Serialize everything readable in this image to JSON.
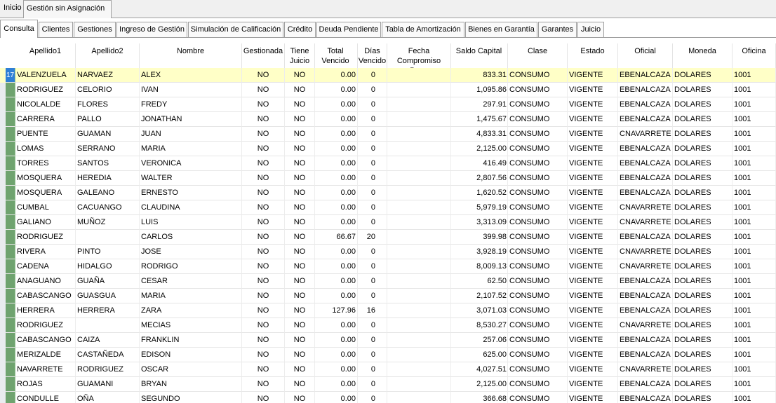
{
  "top_tabs": [
    "Inicio",
    "Gestión sin Asignación"
  ],
  "sub_tabs": [
    "Consulta",
    "Clientes",
    "Gestiones",
    "Ingreso de Gestión",
    "Simulación de Calificación",
    "Crédito",
    "Deuda Pendiente",
    "Tabla de Amortización",
    "Bienes en Garantía",
    "Garantes",
    "Juicio"
  ],
  "columns": {
    "apellido1": "Apellido1",
    "apellido2": "Apellido2",
    "nombre": "Nombre",
    "gestionada": "Gestionada",
    "tiene_juicio": "Tiene\nJuicio",
    "total_vencido": "Total\nVencido",
    "dias_vencido": "Días\nVencido",
    "fecha_compromiso": "Fecha\nCompromiso Pago",
    "saldo_capital": "Saldo Capital",
    "clase": "Clase",
    "estado": "Estado",
    "oficial": "Oficial",
    "moneda": "Moneda",
    "oficina": "Oficina"
  },
  "selected_row_marker": "17",
  "rows": [
    [
      "VALENZUELA",
      "NARVAEZ",
      "ALEX",
      "NO",
      "NO",
      "0.00",
      "0",
      "",
      "833.31",
      "CONSUMO",
      "VIGENTE",
      "EBENALCAZA",
      "DOLARES",
      "1001"
    ],
    [
      "RODRIGUEZ",
      "CELORIO",
      "IVAN",
      "NO",
      "NO",
      "0.00",
      "0",
      "",
      "1,095.86",
      "CONSUMO",
      "VIGENTE",
      "EBENALCAZA",
      "DOLARES",
      "1001"
    ],
    [
      "NICOLALDE",
      "FLORES",
      "FREDY",
      "NO",
      "NO",
      "0.00",
      "0",
      "",
      "297.91",
      "CONSUMO",
      "VIGENTE",
      "EBENALCAZA",
      "DOLARES",
      "1001"
    ],
    [
      "CARRERA",
      "PALLO",
      "JONATHAN",
      "NO",
      "NO",
      "0.00",
      "0",
      "",
      "1,475.67",
      "CONSUMO",
      "VIGENTE",
      "EBENALCAZA",
      "DOLARES",
      "1001"
    ],
    [
      "PUENTE",
      "GUAMAN",
      "JUAN",
      "NO",
      "NO",
      "0.00",
      "0",
      "",
      "4,833.31",
      "CONSUMO",
      "VIGENTE",
      "CNAVARRETE",
      "DOLARES",
      "1001"
    ],
    [
      "LOMAS",
      "SERRANO",
      "MARIA",
      "NO",
      "NO",
      "0.00",
      "0",
      "",
      "2,125.00",
      "CONSUMO",
      "VIGENTE",
      "EBENALCAZA",
      "DOLARES",
      "1001"
    ],
    [
      "TORRES",
      "SANTOS",
      "VERONICA",
      "NO",
      "NO",
      "0.00",
      "0",
      "",
      "416.49",
      "CONSUMO",
      "VIGENTE",
      "EBENALCAZA",
      "DOLARES",
      "1001"
    ],
    [
      "MOSQUERA",
      "HEREDIA",
      "WALTER",
      "NO",
      "NO",
      "0.00",
      "0",
      "",
      "2,807.56",
      "CONSUMO",
      "VIGENTE",
      "EBENALCAZA",
      "DOLARES",
      "1001"
    ],
    [
      "MOSQUERA",
      "GALEANO",
      "ERNESTO",
      "NO",
      "NO",
      "0.00",
      "0",
      "",
      "1,620.52",
      "CONSUMO",
      "VIGENTE",
      "EBENALCAZA",
      "DOLARES",
      "1001"
    ],
    [
      "CUMBAL",
      "CACUANGO",
      "CLAUDINA",
      "NO",
      "NO",
      "0.00",
      "0",
      "",
      "5,979.19",
      "CONSUMO",
      "VIGENTE",
      "CNAVARRETE",
      "DOLARES",
      "1001"
    ],
    [
      "GALIANO",
      "MUÑOZ",
      "LUIS",
      "NO",
      "NO",
      "0.00",
      "0",
      "",
      "3,313.09",
      "CONSUMO",
      "VIGENTE",
      "CNAVARRETE",
      "DOLARES",
      "1001"
    ],
    [
      "RODRIGUEZ",
      "",
      "CARLOS",
      "NO",
      "NO",
      "66.67",
      "20",
      "",
      "399.98",
      "CONSUMO",
      "VIGENTE",
      "EBENALCAZA",
      "DOLARES",
      "1001"
    ],
    [
      "RIVERA",
      "PINTO",
      "JOSE",
      "NO",
      "NO",
      "0.00",
      "0",
      "",
      "3,928.19",
      "CONSUMO",
      "VIGENTE",
      "CNAVARRETE",
      "DOLARES",
      "1001"
    ],
    [
      "CADENA",
      "HIDALGO",
      "RODRIGO",
      "NO",
      "NO",
      "0.00",
      "0",
      "",
      "8,009.13",
      "CONSUMO",
      "VIGENTE",
      "CNAVARRETE",
      "DOLARES",
      "1001"
    ],
    [
      "ANAGUANO",
      "GUAÑA",
      "CESAR",
      "NO",
      "NO",
      "0.00",
      "0",
      "",
      "62.50",
      "CONSUMO",
      "VIGENTE",
      "EBENALCAZA",
      "DOLARES",
      "1001"
    ],
    [
      "CABASCANGO",
      "GUASGUA",
      "MARIA",
      "NO",
      "NO",
      "0.00",
      "0",
      "",
      "2,107.52",
      "CONSUMO",
      "VIGENTE",
      "EBENALCAZA",
      "DOLARES",
      "1001"
    ],
    [
      "HERRERA",
      "HERRERA",
      "ZARA",
      "NO",
      "NO",
      "127.96",
      "16",
      "",
      "3,071.03",
      "CONSUMO",
      "VIGENTE",
      "EBENALCAZA",
      "DOLARES",
      "1001"
    ],
    [
      "RODRIGUEZ",
      "",
      "MECIAS",
      "NO",
      "NO",
      "0.00",
      "0",
      "",
      "8,530.27",
      "CONSUMO",
      "VIGENTE",
      "CNAVARRETE",
      "DOLARES",
      "1001"
    ],
    [
      "CABASCANGO",
      "CAIZA",
      "FRANKLIN",
      "NO",
      "NO",
      "0.00",
      "0",
      "",
      "257.06",
      "CONSUMO",
      "VIGENTE",
      "EBENALCAZA",
      "DOLARES",
      "1001"
    ],
    [
      "MERIZALDE",
      "CASTAÑEDA",
      "EDISON",
      "NO",
      "NO",
      "0.00",
      "0",
      "",
      "625.00",
      "CONSUMO",
      "VIGENTE",
      "EBENALCAZA",
      "DOLARES",
      "1001"
    ],
    [
      "NAVARRETE",
      "RODRIGUEZ",
      "OSCAR",
      "NO",
      "NO",
      "0.00",
      "0",
      "",
      "4,027.51",
      "CONSUMO",
      "VIGENTE",
      "CNAVARRETE",
      "DOLARES",
      "1001"
    ],
    [
      "ROJAS",
      "GUAMANI",
      "BRYAN",
      "NO",
      "NO",
      "0.00",
      "0",
      "",
      "2,125.00",
      "CONSUMO",
      "VIGENTE",
      "EBENALCAZA",
      "DOLARES",
      "1001"
    ],
    [
      "CONDULLE",
      "OÑA",
      "SEGUNDO",
      "NO",
      "NO",
      "0.00",
      "0",
      "",
      "366.68",
      "CONSUMO",
      "VIGENTE",
      "EBENALCAZA",
      "DOLARES",
      "1001"
    ]
  ]
}
